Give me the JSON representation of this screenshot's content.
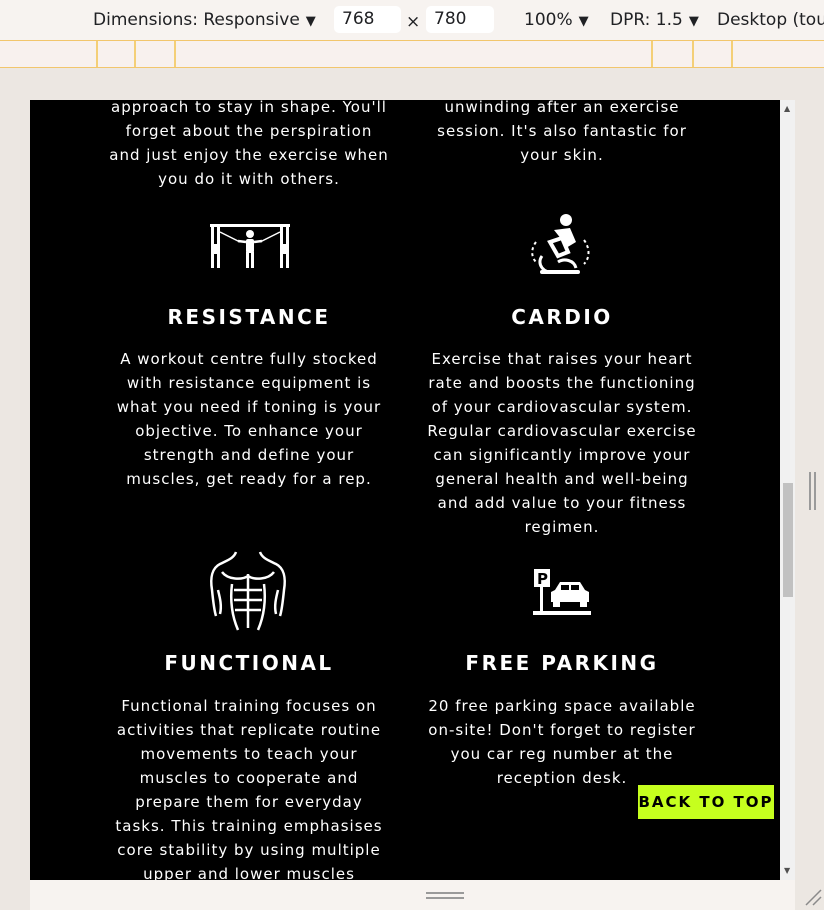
{
  "devtools": {
    "dimensions_label": "Dimensions: Responsive",
    "width_value": "768",
    "times": "×",
    "height_value": "780",
    "zoom": "100%",
    "dpr": "DPR: 1.5",
    "device_mode": "Desktop (touc"
  },
  "sections": {
    "top_left_text": [
      "approach to stay in shape. You'll",
      "forget about the perspiration",
      "and just enjoy the exercise when",
      "you do it with others."
    ],
    "top_right_text": [
      "unwinding after an exercise",
      "session. It's also fantastic for",
      "your skin."
    ],
    "resistance": {
      "icon": "cable-machine-icon",
      "title": "RESISTANCE",
      "lines": [
        "A workout centre fully stocked",
        "with resistance equipment is",
        "what you need if toning is your",
        "objective. To enhance your",
        "strength and define your",
        "muscles, get ready for a rep."
      ]
    },
    "cardio": {
      "icon": "exercise-bike-icon",
      "title": "CARDIO",
      "lines": [
        "Exercise that raises your heart",
        "rate and boosts the functioning",
        "of your cardiovascular system.",
        "Regular cardiovascular exercise",
        "can significantly improve your",
        "general health and well-being",
        "and add value to your fitness",
        "regimen."
      ]
    },
    "functional": {
      "icon": "muscular-torso-icon",
      "title": "FUNCTIONAL",
      "lines": [
        "Functional training focuses on",
        "activities that replicate routine",
        "movements to teach your",
        "muscles to cooperate and",
        "prepare them for everyday",
        "tasks. This training emphasises",
        "core stability by using multiple",
        "upper and lower muscles"
      ]
    },
    "free_parking": {
      "icon": "parking-car-icon",
      "title": "FREE PARKING",
      "lines": [
        "20 free parking space available",
        "on-site! Don't forget to register",
        "you car reg number at the",
        "reception desk."
      ]
    }
  },
  "back_to_top": "BACK TO TOP",
  "colors": {
    "background": "#000000",
    "text": "#ffffff",
    "accent": "#c6ff1e"
  }
}
